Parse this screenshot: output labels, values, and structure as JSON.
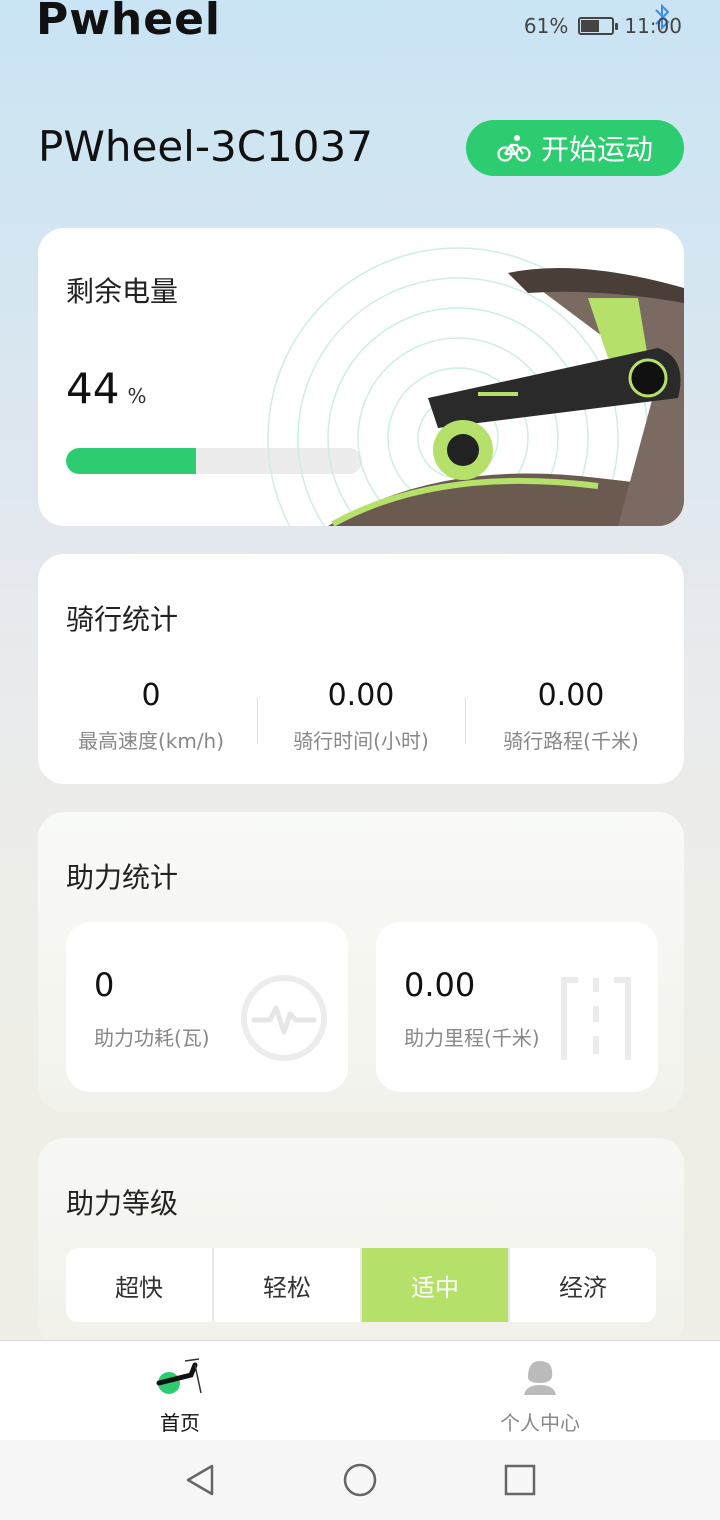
{
  "status_bar": {
    "brand_logo": "Pwheel",
    "battery_percent": "61%",
    "battery_level": 0.61,
    "time": "11:00",
    "icons": [
      "bluetooth-icon",
      "battery-icon"
    ]
  },
  "header": {
    "device_name": "PWheel-3C1037",
    "start_button_label": "开始运动",
    "start_button_icon": "bike-icon"
  },
  "battery": {
    "title": "剩余电量",
    "value": "44",
    "unit": "%",
    "level": 0.44
  },
  "ride_stats": {
    "title": "骑行统计",
    "items": [
      {
        "value": "0",
        "label": "最高速度(km/h)"
      },
      {
        "value": "0.00",
        "label": "骑行时间(小时)"
      },
      {
        "value": "0.00",
        "label": "骑行路程(千米)"
      }
    ]
  },
  "assist_stats": {
    "title": "助力统计",
    "items": [
      {
        "value": "0",
        "label": "助力功耗(瓦)",
        "icon": "pulse-gauge-icon"
      },
      {
        "value": "0.00",
        "label": "助力里程(千米)",
        "icon": "road-icon"
      }
    ]
  },
  "assist_level": {
    "title": "助力等级",
    "options": [
      "超快",
      "轻松",
      "适中",
      "经济"
    ],
    "selected": "适中"
  },
  "bottom_nav": {
    "items": [
      {
        "label": "首页",
        "active": true
      },
      {
        "label": "个人中心",
        "active": false
      }
    ]
  },
  "colors": {
    "accent_green": "#2ecc71",
    "active_level": "#b5e06a"
  }
}
